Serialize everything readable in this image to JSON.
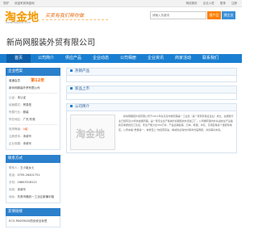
{
  "topbar": {
    "left_items": [
      "您好",
      "欢迎来到淘金地"
    ],
    "right_items": [
      "网站首页",
      "企业入驻",
      "登录",
      "注册"
    ]
  },
  "header": {
    "logo_text": "淘金地",
    "logo_url": "www.taojindi.com",
    "slogan": "买卖有我们帮你做",
    "search_placeholder": "请输入关键词",
    "search_btn_products": "搜产品",
    "search_btn_companies": "搜企业"
  },
  "company_name": "新尚网服装外贸有限公司",
  "nav": {
    "items": [
      "首页",
      "公司简介",
      "供应产品",
      "企业动态",
      "公司相册",
      "企业资讯",
      "商家活动",
      "联系我们"
    ],
    "active_index": 0
  },
  "sidebar": {
    "info_head": "企业档案",
    "level_label": "普通会员",
    "years_value": "第12年",
    "company_name": "新尚网服装外贸有限公司",
    "auth_label": "认证：",
    "auth_value": "未认证",
    "biz_model_label": "经营模式：",
    "biz_model_value": "贸易型",
    "industry_label": "所属行业：",
    "industry_value": "服装",
    "region_label": "所在地区：",
    "region_value": "广东/东莞",
    "credit_label": "信用等级：",
    "credit_value": "A级",
    "reg_capital_label": "注册资本：",
    "reg_capital_value": "未填写",
    "scale_label": "企业规模：",
    "scale_value": "未填写",
    "contact_head": "联系方式",
    "contact_person_label": "联系人：",
    "contact_person_value": "王小姐女士",
    "phone_label": "电话：",
    "phone_value": "0755-26401751",
    "mobile_label": "手机：",
    "mobile_value": "18603518121",
    "fax_label": "传真：",
    "fax_value": "未填写",
    "address_label": "地址：",
    "address_value": "东莞市横沥一工业区新横中路",
    "friend_head": "友情链接",
    "friend_item": "ECO-PASSPACK防伪安全标签"
  },
  "main": {
    "hot_head": "热销产品",
    "new_head": "新品上市",
    "about_head": "公司简介",
    "about_thumb_mark": "淘金地",
    "about_text": "新尚网服装外贸有限公司于2011年在东莞市横沥镇第一工业区（第一家家有保证企业）成立，在服装行业已经有近10年的发展历程，是一家专业生产各类针织服装的外贸加工厂。公司拥有国内外先进的生产设备和高素质的员工队伍，年生产能力达300万件，产品远销欧美、日本、韩国、中东、东南亚等多个国家和地区。公司本着“质量第一，信誉至上”的经营宗旨，竭诚欢迎海内外客商光临惠顾，共创美好未来。"
  }
}
